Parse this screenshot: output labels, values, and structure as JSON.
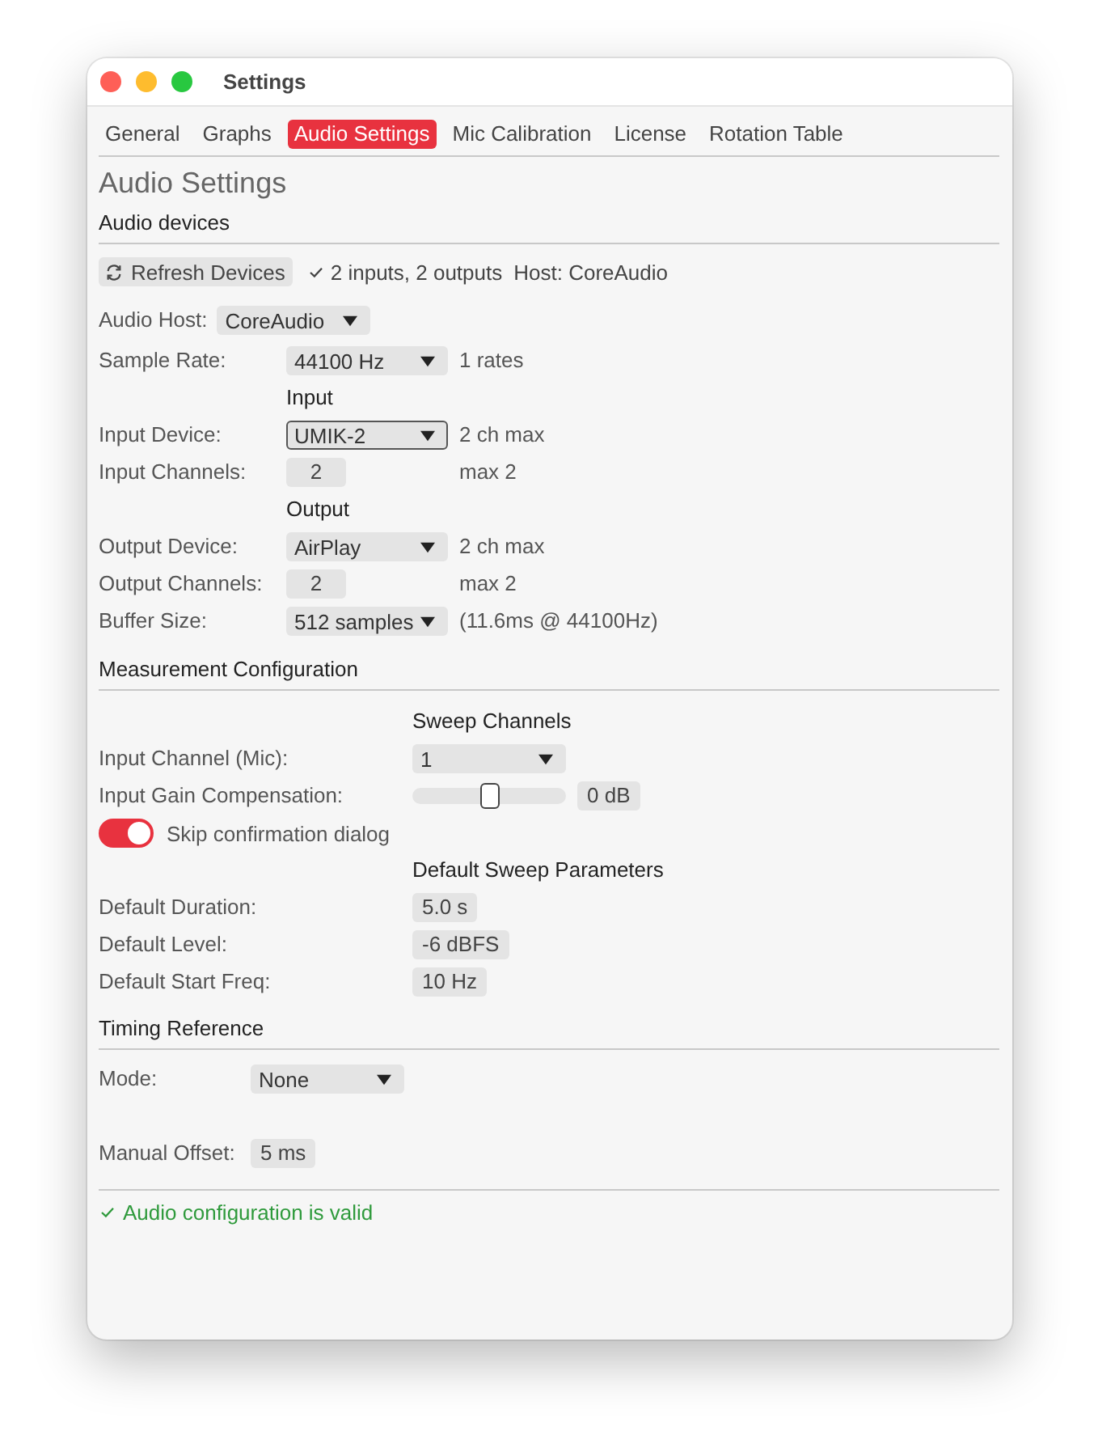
{
  "window": {
    "title": "Settings"
  },
  "tabs": [
    {
      "label": "General",
      "selected": false
    },
    {
      "label": "Graphs",
      "selected": false
    },
    {
      "label": "Audio Settings",
      "selected": true
    },
    {
      "label": "Mic Calibration",
      "selected": false
    },
    {
      "label": "License",
      "selected": false
    },
    {
      "label": "Rotation Table",
      "selected": false
    }
  ],
  "page_title": "Audio Settings",
  "audio_devices": {
    "heading": "Audio devices",
    "refresh_button": "Refresh Devices",
    "device_summary": "2 inputs, 2 outputs",
    "host_summary": "Host: CoreAudio",
    "audio_host": {
      "label": "Audio Host:",
      "value": "CoreAudio",
      "focused": false
    },
    "rows": [
      {
        "kind": "dropdown",
        "label": "Sample Rate:",
        "value": "44100 Hz",
        "note": "1 rates",
        "focused": false
      },
      {
        "kind": "subheading",
        "text": "Input"
      },
      {
        "kind": "dropdown",
        "label": "Input Device:",
        "value": "UMIK-2",
        "note": "2 ch max",
        "focused": true
      },
      {
        "kind": "spinbox",
        "label": "Input Channels:",
        "value": "2",
        "note": "max 2"
      },
      {
        "kind": "subheading",
        "text": "Output"
      },
      {
        "kind": "dropdown",
        "label": "Output Device:",
        "value": "AirPlay",
        "note": "2 ch max",
        "focused": false
      },
      {
        "kind": "spinbox",
        "label": "Output Channels:",
        "value": "2",
        "note": "max 2"
      },
      {
        "kind": "dropdown",
        "label": "Buffer Size:",
        "value": "512 samples",
        "note": "(11.6ms @ 44100Hz)",
        "focused": false
      }
    ]
  },
  "measurement": {
    "heading": "Measurement Configuration",
    "rows": [
      {
        "kind": "subheading",
        "text": "Sweep Channels"
      },
      {
        "kind": "dropdown",
        "label": "Input Channel (Mic):",
        "value": "1",
        "focused": false
      },
      {
        "kind": "slider",
        "label": "Input Gain Compensation:",
        "level": 0.5,
        "reading": "0 dB"
      },
      {
        "kind": "toggle",
        "label": "Skip confirmation dialog",
        "on": true
      },
      {
        "kind": "subheading",
        "text": "Default Sweep Parameters"
      },
      {
        "kind": "value",
        "label": "Default Duration:",
        "value": "5.0 s"
      },
      {
        "kind": "value",
        "label": "Default Level:",
        "value": "-6 dBFS"
      },
      {
        "kind": "value",
        "label": "Default Start Freq:",
        "value": "10 Hz"
      }
    ]
  },
  "timing": {
    "heading": "Timing Reference",
    "rows": [
      {
        "kind": "dropdown",
        "label": "Mode:",
        "value": "None",
        "focused": false
      },
      {
        "kind": "value",
        "label": "Manual Offset:",
        "value": "5 ms"
      }
    ]
  },
  "status": {
    "text": "Audio configuration is valid",
    "valid": true
  }
}
